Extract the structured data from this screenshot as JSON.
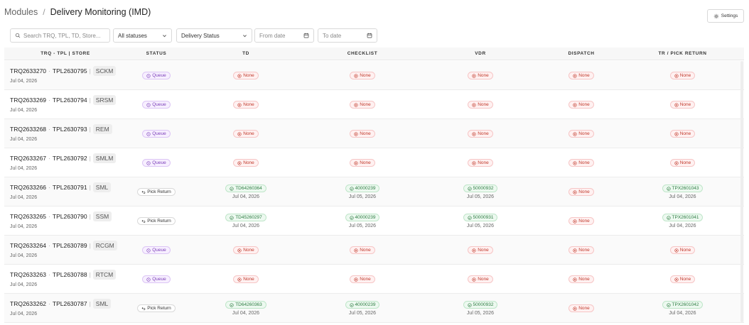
{
  "breadcrumb": {
    "root": "Modules",
    "separator": "/",
    "current": "Delivery Monitoring (IMD)"
  },
  "settings": {
    "label": "Settings",
    "icon": "gear-icon"
  },
  "filters": {
    "search_placeholder": "Search TRQ, TPL, TD, Store...",
    "status_value": "All statuses",
    "delivery_value": "Delivery Status",
    "from_placeholder": "From date",
    "to_placeholder": "To date"
  },
  "columns": [
    "TRQ - TPL | STORE",
    "STATUS",
    "TD",
    "CHECKLIST",
    "VDR",
    "DISPATCH",
    "TR / PICK RETURN"
  ],
  "rows": [
    {
      "trq": "TRQ2633270",
      "tpl": "TPL2630795",
      "store": "SCKM",
      "date": "Jul 04, 2026",
      "status": "Queue",
      "status_type": "queue",
      "td": {
        "label": "None",
        "type": "none",
        "date": ""
      },
      "checklist": {
        "label": "None",
        "type": "none",
        "date": ""
      },
      "vdr": {
        "label": "None",
        "type": "none",
        "date": ""
      },
      "dispatch": {
        "label": "None",
        "type": "none",
        "date": ""
      },
      "tr": {
        "label": "None",
        "type": "none",
        "date": ""
      }
    },
    {
      "trq": "TRQ2633269",
      "tpl": "TPL2630794",
      "store": "SRSM",
      "date": "Jul 04, 2026",
      "status": "Queue",
      "status_type": "queue",
      "td": {
        "label": "None",
        "type": "none",
        "date": ""
      },
      "checklist": {
        "label": "None",
        "type": "none",
        "date": ""
      },
      "vdr": {
        "label": "None",
        "type": "none",
        "date": ""
      },
      "dispatch": {
        "label": "None",
        "type": "none",
        "date": ""
      },
      "tr": {
        "label": "None",
        "type": "none",
        "date": ""
      }
    },
    {
      "trq": "TRQ2633268",
      "tpl": "TPL2630793",
      "store": "REM",
      "date": "Jul 04, 2026",
      "status": "Queue",
      "status_type": "queue",
      "td": {
        "label": "None",
        "type": "none",
        "date": ""
      },
      "checklist": {
        "label": "None",
        "type": "none",
        "date": ""
      },
      "vdr": {
        "label": "None",
        "type": "none",
        "date": ""
      },
      "dispatch": {
        "label": "None",
        "type": "none",
        "date": ""
      },
      "tr": {
        "label": "None",
        "type": "none",
        "date": ""
      }
    },
    {
      "trq": "TRQ2633267",
      "tpl": "TPL2630792",
      "store": "SMLM",
      "date": "Jul 04, 2026",
      "status": "Queue",
      "status_type": "queue",
      "td": {
        "label": "None",
        "type": "none",
        "date": ""
      },
      "checklist": {
        "label": "None",
        "type": "none",
        "date": ""
      },
      "vdr": {
        "label": "None",
        "type": "none",
        "date": ""
      },
      "dispatch": {
        "label": "None",
        "type": "none",
        "date": ""
      },
      "tr": {
        "label": "None",
        "type": "none",
        "date": ""
      }
    },
    {
      "trq": "TRQ2633266",
      "tpl": "TPL2630791",
      "store": "SML",
      "date": "Jul 04, 2026",
      "status": "Pick Return",
      "status_type": "pick",
      "td": {
        "label": "TD64260364",
        "type": "ok",
        "date": "Jul 04, 2026"
      },
      "checklist": {
        "label": "40000239",
        "type": "ok",
        "date": "Jul 05, 2026"
      },
      "vdr": {
        "label": "50000932",
        "type": "ok",
        "date": "Jul 05, 2026"
      },
      "dispatch": {
        "label": "None",
        "type": "none",
        "date": ""
      },
      "tr": {
        "label": "TPX2601043",
        "type": "ok",
        "date": "Jul 04, 2026"
      }
    },
    {
      "trq": "TRQ2633265",
      "tpl": "TPL2630790",
      "store": "SSM",
      "date": "Jul 04, 2026",
      "status": "Pick Return",
      "status_type": "pick",
      "td": {
        "label": "TD45260297",
        "type": "ok",
        "date": "Jul 04, 2026"
      },
      "checklist": {
        "label": "40000239",
        "type": "ok",
        "date": "Jul 05, 2026"
      },
      "vdr": {
        "label": "50000931",
        "type": "ok",
        "date": "Jul 05, 2026"
      },
      "dispatch": {
        "label": "None",
        "type": "none",
        "date": ""
      },
      "tr": {
        "label": "TPX2601041",
        "type": "ok",
        "date": "Jul 04, 2026"
      }
    },
    {
      "trq": "TRQ2633264",
      "tpl": "TPL2630789",
      "store": "RCGM",
      "date": "Jul 04, 2026",
      "status": "Queue",
      "status_type": "queue",
      "td": {
        "label": "None",
        "type": "none",
        "date": ""
      },
      "checklist": {
        "label": "None",
        "type": "none",
        "date": ""
      },
      "vdr": {
        "label": "None",
        "type": "none",
        "date": ""
      },
      "dispatch": {
        "label": "None",
        "type": "none",
        "date": ""
      },
      "tr": {
        "label": "None",
        "type": "none",
        "date": ""
      }
    },
    {
      "trq": "TRQ2633263",
      "tpl": "TPL2630788",
      "store": "RTCM",
      "date": "Jul 04, 2026",
      "status": "Queue",
      "status_type": "queue",
      "td": {
        "label": "None",
        "type": "none",
        "date": ""
      },
      "checklist": {
        "label": "None",
        "type": "none",
        "date": ""
      },
      "vdr": {
        "label": "None",
        "type": "none",
        "date": ""
      },
      "dispatch": {
        "label": "None",
        "type": "none",
        "date": ""
      },
      "tr": {
        "label": "None",
        "type": "none",
        "date": ""
      }
    },
    {
      "trq": "TRQ2633262",
      "tpl": "TPL2630787",
      "store": "SML",
      "date": "Jul 04, 2026",
      "status": "Pick Return",
      "status_type": "pick",
      "td": {
        "label": "TD64260363",
        "type": "ok",
        "date": "Jul 04, 2026"
      },
      "checklist": {
        "label": "40000239",
        "type": "ok",
        "date": "Jul 05, 2026"
      },
      "vdr": {
        "label": "50000932",
        "type": "ok",
        "date": "Jul 05, 2026"
      },
      "dispatch": {
        "label": "None",
        "type": "none",
        "date": ""
      },
      "tr": {
        "label": "TPX2601042",
        "type": "ok",
        "date": "Jul 04, 2026"
      }
    }
  ]
}
